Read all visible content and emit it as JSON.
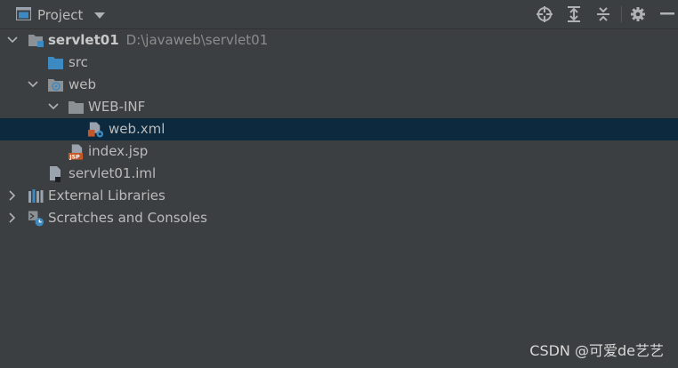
{
  "header": {
    "title": "Project",
    "dropdown_icon": "chevron-down-icon"
  },
  "toolbar": {
    "locate_icon": "crosshair-icon",
    "expand_icon": "expand-all-icon",
    "collapse_icon": "collapse-all-icon",
    "settings_icon": "gear-icon",
    "hide_icon": "minimize-icon"
  },
  "tree": {
    "root": {
      "label": "servlet01",
      "path": "D:\\javaweb\\servlet01"
    },
    "src": {
      "label": "src"
    },
    "web": {
      "label": "web"
    },
    "web_inf": {
      "label": "WEB-INF"
    },
    "web_xml": {
      "label": "web.xml"
    },
    "index_jsp": {
      "label": "index.jsp"
    },
    "iml": {
      "label": "servlet01.iml"
    },
    "external_libraries": {
      "label": "External Libraries"
    },
    "scratches": {
      "label": "Scratches and Consoles"
    }
  },
  "watermark": "CSDN @可爱de艺艺",
  "colors": {
    "background": "#3c3f41",
    "selection": "#0d293e",
    "folder_blue": "#3d8ac2",
    "folder_gray": "#8c9196",
    "jsp_orange": "#c4582b"
  }
}
